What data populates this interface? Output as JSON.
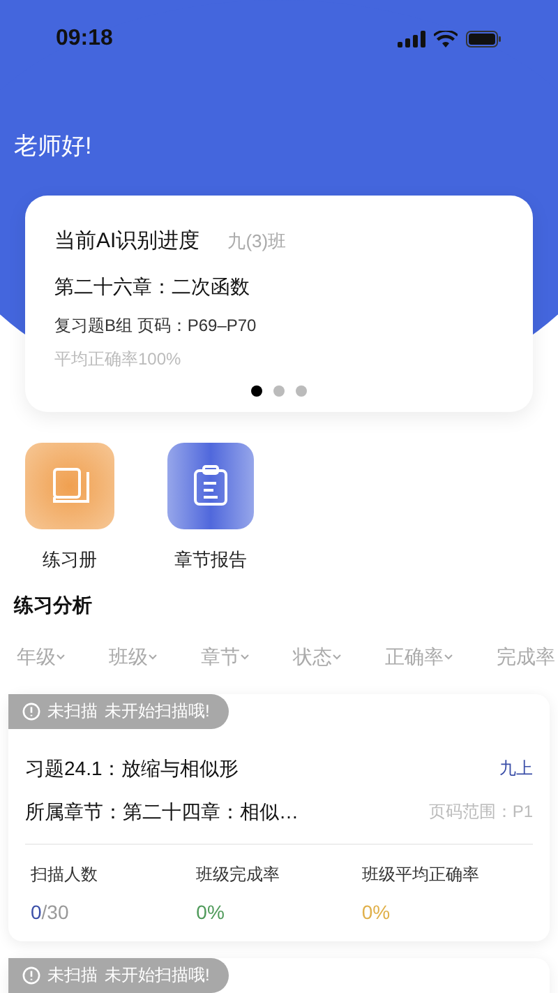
{
  "status_bar": {
    "time": "09:18"
  },
  "greeting": "老师好!",
  "progress_card": {
    "title": "当前AI识别进度",
    "class": "九(3)班",
    "chapter": "第二十六章：二次函数",
    "section": "复习题B组 页码：P69–P70",
    "accuracy": "平均正确率100%",
    "dots": [
      {
        "selected": true
      },
      {
        "selected": false
      },
      {
        "selected": false
      }
    ]
  },
  "shortcuts": [
    {
      "kind": "book",
      "label": "练习册"
    },
    {
      "kind": "report",
      "label": "章节报告"
    }
  ],
  "section_title": "练习分析",
  "filters": [
    {
      "label": "年级",
      "has_caret": true
    },
    {
      "label": "班级",
      "has_caret": true
    },
    {
      "label": "章节",
      "has_caret": true
    },
    {
      "label": "状态",
      "has_caret": true
    },
    {
      "label": "正确率",
      "has_caret": true
    },
    {
      "label": "完成率",
      "has_caret": false
    }
  ],
  "tasks": [
    {
      "status": "未扫描",
      "message": "未开始扫描哦!",
      "title": "习题24.1：放缩与相似形",
      "grade": "九上",
      "chapter": "所属章节：第二十四章：相似…",
      "pages": "页码范围：P1",
      "stats": [
        {
          "label": "扫描人数",
          "value": "0",
          "total": "/30",
          "color": "#3b4fa8"
        },
        {
          "label": "班级完成率",
          "value": "0%",
          "color": "#4f9a5a"
        },
        {
          "label": "班级平均正确率",
          "value": "0%",
          "color": "#e0b04a"
        }
      ]
    },
    {
      "status": "未扫描",
      "message": "未开始扫描哦!"
    }
  ]
}
